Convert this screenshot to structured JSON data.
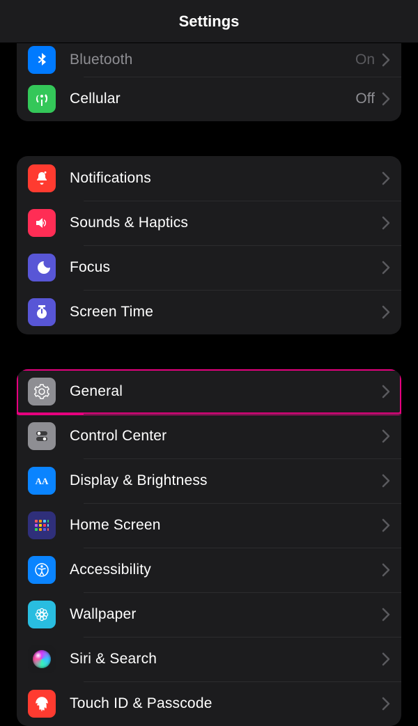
{
  "header": {
    "title": "Settings"
  },
  "groups": {
    "connectivity": {
      "bluetooth": {
        "label": "Bluetooth",
        "value": "On"
      },
      "cellular": {
        "label": "Cellular",
        "value": "Off"
      }
    },
    "alerts": {
      "notifications": {
        "label": "Notifications"
      },
      "sounds": {
        "label": "Sounds & Haptics"
      },
      "focus": {
        "label": "Focus"
      },
      "screentime": {
        "label": "Screen Time"
      }
    },
    "general_group": {
      "general": {
        "label": "General"
      },
      "controlcenter": {
        "label": "Control Center"
      },
      "display": {
        "label": "Display & Brightness"
      },
      "homescreen": {
        "label": "Home Screen"
      },
      "accessibility": {
        "label": "Accessibility"
      },
      "wallpaper": {
        "label": "Wallpaper"
      },
      "siri": {
        "label": "Siri & Search"
      },
      "touchid": {
        "label": "Touch ID & Passcode"
      }
    }
  },
  "colors": {
    "bluetooth": "#007aff",
    "cellular": "#34c759",
    "notifications": "#ff3b30",
    "sounds": "#ff2d55",
    "focus": "#5856d6",
    "screentime": "#5856d6",
    "general": "#8e8e93",
    "controlcenter": "#8e8e93",
    "display": "#0a84ff",
    "homescreen": "#2f2f7a",
    "accessibility": "#0a84ff",
    "wallpaper": "#29bde0",
    "siri": "#1b1b1d",
    "touchid": "#ff3b30",
    "highlight": "#e6007e"
  }
}
